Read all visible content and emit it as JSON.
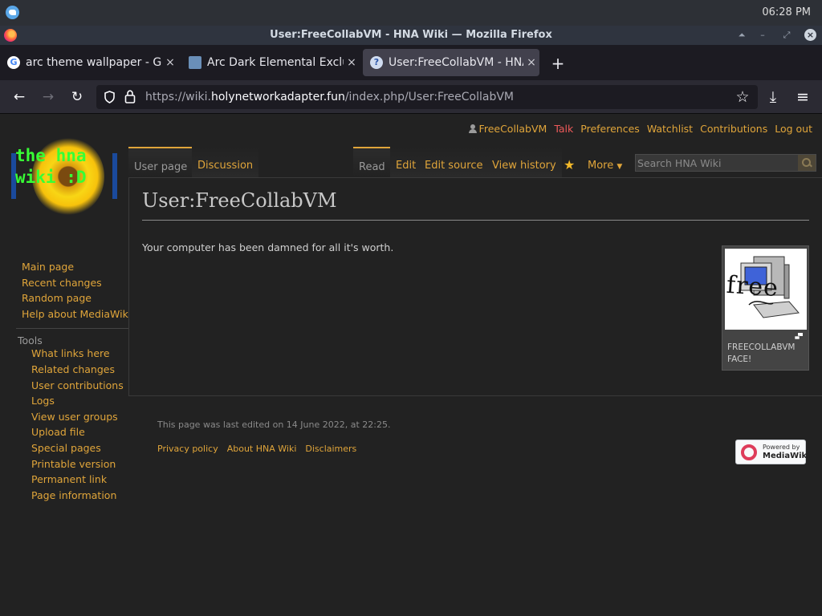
{
  "system": {
    "clock": "06:28 PM"
  },
  "window": {
    "title": "User:FreeCollabVM - HNA Wiki — Mozilla Firefox",
    "minimize": "⏶",
    "restore": "–",
    "maximize": "⤢",
    "close": "×"
  },
  "tabs": [
    {
      "title": "arc theme wallpaper - Go",
      "favicon": "G",
      "close": "×"
    },
    {
      "title": "Arc Dark Elemental Exclu",
      "favicon": "",
      "close": "×"
    },
    {
      "title": "User:FreeCollabVM - HNA",
      "favicon": "?",
      "close": "×"
    }
  ],
  "newtab": "+",
  "nav": {
    "back": "←",
    "forward": "→",
    "reload": "↻",
    "url_prefix": "https://wiki.",
    "url_host": "holynetworkadapter.fun",
    "url_path": "/index.php/User:FreeCollabVM",
    "bookmark": "☆",
    "downloads": "⤓",
    "menu": "≡"
  },
  "personal": {
    "user": "FreeCollabVM",
    "talk": "Talk",
    "preferences": "Preferences",
    "watchlist": "Watchlist",
    "contributions": "Contributions",
    "logout": "Log out"
  },
  "logo": {
    "line1": "the hna",
    "line2": "wiki :D"
  },
  "sidebar": {
    "nav": [
      "Main page",
      "Recent changes",
      "Random page",
      "Help about MediaWiki"
    ],
    "tools_heading": "Tools",
    "tools": [
      "What links here",
      "Related changes",
      "User contributions",
      "Logs",
      "View user groups",
      "Upload file",
      "Special pages",
      "Printable version",
      "Permanent link",
      "Page information"
    ]
  },
  "page_tabs": {
    "user_page": "User page",
    "discussion": "Discussion",
    "read": "Read",
    "edit": "Edit",
    "edit_source": "Edit source",
    "view_history": "View history",
    "more": "More",
    "watch": "★"
  },
  "search": {
    "placeholder": "Search HNA Wiki"
  },
  "content": {
    "title": "User:FreeCollabVM",
    "body": "Your computer has been damned for all it's worth.",
    "thumb_caption": "FREECOLLABVM FACE!",
    "thumb_text": "free"
  },
  "footer": {
    "last_edited": "This page was last edited on 14 June 2022, at 22:25.",
    "links": [
      "Privacy policy",
      "About HNA Wiki",
      "Disclaimers"
    ],
    "powered_line1": "Powered by",
    "powered_line2": "MediaWiki"
  }
}
